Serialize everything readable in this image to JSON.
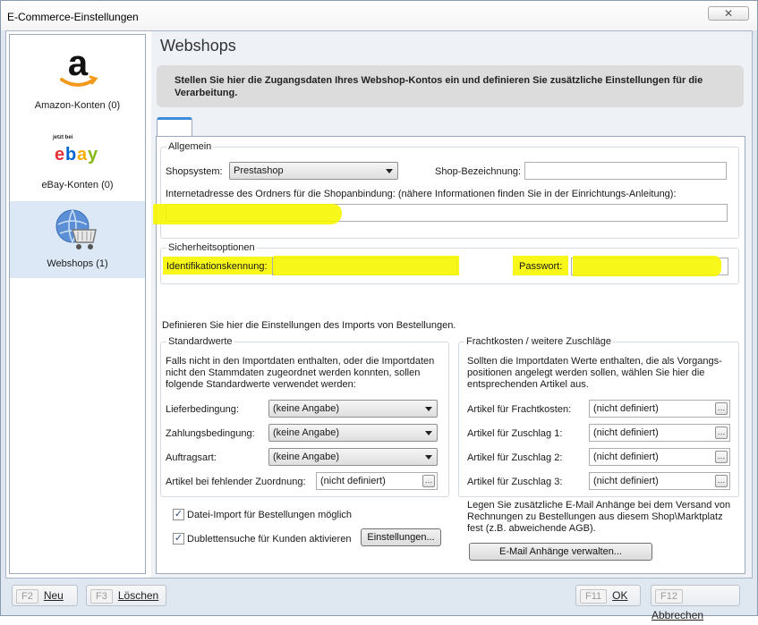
{
  "window": {
    "title": "E-Commerce-Einstellungen",
    "close_label": "✕"
  },
  "sidebar": {
    "items": [
      {
        "label": "Amazon-Konten (0)",
        "icon": "amazon-logo"
      },
      {
        "label": "eBay-Konten (0)",
        "icon": "ebay-logo",
        "badge": "jetzt bei"
      },
      {
        "label": "Webshops (1)",
        "icon": "webshop-globe-cart-icon",
        "selected": true
      }
    ]
  },
  "main": {
    "title": "Webshops",
    "info": "Stellen Sie hier die Zugangsdaten Ihres Webshop-Kontos ein und definieren Sie zusätzliche Einstellungen für die Verarbeitung."
  },
  "allgemein": {
    "legend": "Allgemein",
    "shopsystem_label": "Shopsystem:",
    "shopsystem_value": "Prestashop",
    "shop_bezeichnung_label": "Shop-Bezeichnung:",
    "shop_bezeichnung_value": "",
    "url_label": "Internetadresse des Ordners für die Shopanbindung: (nähere Informationen finden Sie in der Einrichtungs-Anleitung):",
    "url_value": ""
  },
  "sicherheit": {
    "legend": "Sicherheitsoptionen",
    "ident_label": "Identifikationskennung:",
    "ident_value": "",
    "passwort_label": "Passwort:",
    "passwort_value": ""
  },
  "import_intro": "Definieren Sie hier die Einstellungen des Imports von Bestellungen.",
  "standardwerte": {
    "legend": "Standardwerte",
    "desc": "Falls nicht in den Importdaten enthalten, oder die Importdaten nicht den Stammdaten zugeordnet werden konnten, sollen folgende Standardwerte verwendet werden:",
    "lieferbedingung_label": "Lieferbedingung:",
    "lieferbedingung_value": "(keine Angabe)",
    "zahlungsbedingung_label": "Zahlungsbedingung:",
    "zahlungsbedingung_value": "(keine Angabe)",
    "auftragsart_label": "Auftragsart:",
    "auftragsart_value": "(keine Angabe)",
    "artikel_label": "Artikel bei fehlender Zuordnung:",
    "artikel_value": "(nicht definiert)"
  },
  "fracht": {
    "legend": "Frachtkosten / weitere Zuschläge",
    "desc": "Sollten die Importdaten Werte enthalten, die als Vorgangs-positionen angelegt werden sollen, wählen Sie hier die entsprechenden Artikel aus.",
    "rows": [
      {
        "label": "Artikel für Frachtkosten:",
        "value": "(nicht definiert)"
      },
      {
        "label": "Artikel für Zuschlag 1:",
        "value": "(nicht definiert)"
      },
      {
        "label": "Artikel für Zuschlag 2:",
        "value": "(nicht definiert)"
      },
      {
        "label": "Artikel für Zuschlag 3:",
        "value": "(nicht definiert)"
      }
    ]
  },
  "options": {
    "datei_import_label": "Datei-Import für Bestellungen möglich",
    "datei_import_checked": true,
    "dubletten_label": "Dublettensuche für Kunden aktivieren",
    "dubletten_checked": true,
    "einstellungen_button": "Einstellungen..."
  },
  "email": {
    "desc": "Legen Sie zusätzliche E-Mail Anhänge bei dem Versand von Rechnungen zu Bestellungen aus diesem Shop\\Marktplatz fest (z.B. abweichende AGB).",
    "button": "E-Mail Anhänge verwalten..."
  },
  "footer": {
    "neu": {
      "key": "F2",
      "label": "Neu"
    },
    "loeschen": {
      "key": "F3",
      "label": "Löschen"
    },
    "ok": {
      "key": "F11",
      "label": "OK"
    },
    "abbrechen": {
      "key": "F12",
      "label": "Abbrechen"
    }
  },
  "colors": {
    "highlight": "#f6f600",
    "accent": "#3c8ddc",
    "selection": "#dce8f6"
  }
}
